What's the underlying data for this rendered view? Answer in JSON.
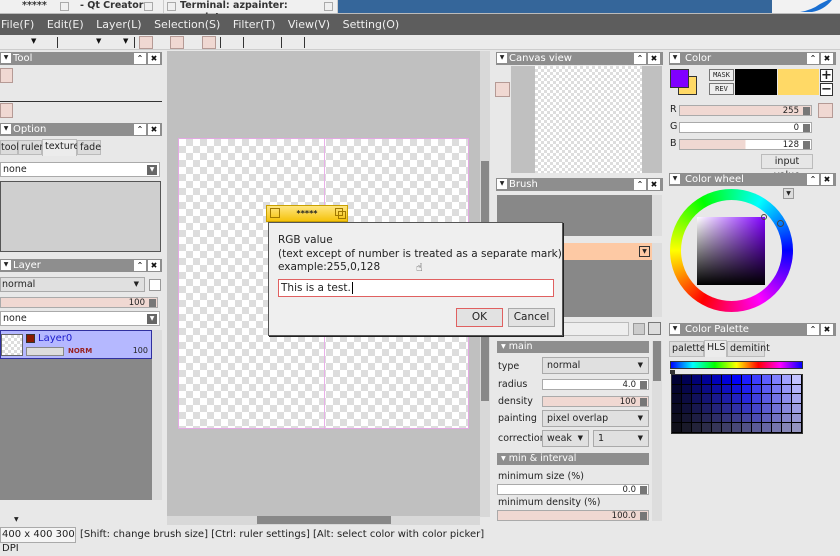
{
  "taskbar": {
    "items": [
      {
        "label": "*****"
      },
      {
        "label": "- Qt Creator"
      },
      {
        "label": "Terminal: azpainter: azpainter"
      }
    ]
  },
  "menubar": {
    "items": [
      "File(F)",
      "Edit(E)",
      "Layer(L)",
      "Selection(S)",
      "Filter(T)",
      "View(V)",
      "Setting(O)"
    ]
  },
  "panels": {
    "tool": {
      "title": "Tool"
    },
    "option": {
      "title": "Option",
      "tabs": [
        "tool",
        "ruler",
        "texture",
        "fade"
      ],
      "active_tab": "texture",
      "texture_select": "none"
    },
    "layer": {
      "title": "Layer",
      "blend_mode": "normal",
      "opacity": "100",
      "texture_select": "none",
      "layers": [
        {
          "name": "Layer0",
          "mode": "NORM",
          "opacity": "100"
        }
      ]
    },
    "canvas_view": {
      "title": "Canvas view"
    },
    "brush": {
      "title": "Brush",
      "main_section": "main",
      "fields": {
        "type_label": "type",
        "type_value": "normal",
        "radius_label": "radius",
        "radius_value": "4.0",
        "density_label": "density",
        "density_value": "100",
        "painting_label": "painting",
        "painting_value": "pixel overlap",
        "correction_label": "correction",
        "correction_value": "weak",
        "correction_level": "1"
      },
      "min_section": "min & interval",
      "min_size_label": "minimum size (%)",
      "min_size_value": "0.0",
      "min_density_label": "minimum density (%)",
      "min_density_value": "100.0"
    },
    "color": {
      "title": "Color",
      "mask_label": "MASK",
      "rev_label": "REV",
      "r_label": "R",
      "r_value": "255",
      "g_label": "G",
      "g_value": "0",
      "b_label": "B",
      "b_value": "128",
      "input_value_label": "input value",
      "foreground": "#8000ff",
      "background": "#ffd966"
    },
    "color_wheel": {
      "title": "Color wheel"
    },
    "color_palette": {
      "title": "Color Palette",
      "tabs": [
        "palette",
        "HLS",
        "demitint"
      ],
      "active_tab": "HLS"
    }
  },
  "dialog": {
    "tab_title": "*****",
    "line1": "RGB value",
    "line2": "(text except of number is treated as a separate mark)",
    "line3": "example:255,0,128",
    "input_value": "This is a test.",
    "ok_label": "OK",
    "cancel_label": "Cancel"
  },
  "status": {
    "size": "400 x 400 300 DPI",
    "hint": "[Shift: change brush size] [Ctrl: ruler settings] [Alt: select color with color picker]"
  }
}
